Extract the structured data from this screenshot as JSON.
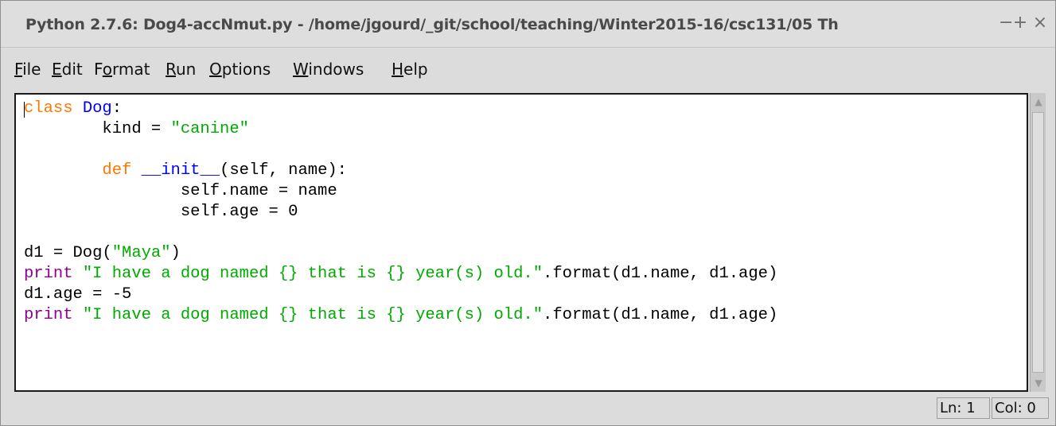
{
  "window": {
    "title": "Python 2.7.6: Dog4-accNmut.py - /home/jgourd/_git/school/teaching/Winter2015-16/csc131/05 Th",
    "controls": {
      "minimize": "−",
      "maximize": "+",
      "close": "×"
    }
  },
  "menu": {
    "file": {
      "mnemonic": "F",
      "rest": "ile"
    },
    "edit": {
      "mnemonic": "E",
      "rest": "dit"
    },
    "format": {
      "pre": "F",
      "mnemonic": "o",
      "rest": "rmat"
    },
    "run": {
      "mnemonic": "R",
      "rest": "un"
    },
    "options": {
      "mnemonic": "O",
      "rest": "ptions"
    },
    "windows": {
      "mnemonic": "W",
      "rest": "indows"
    },
    "help": {
      "mnemonic": "H",
      "rest": "elp"
    }
  },
  "editor": {
    "lines": [
      [
        {
          "t": "class ",
          "c": "kw"
        },
        {
          "t": "Dog",
          "c": "def"
        },
        {
          "t": ":",
          "c": ""
        }
      ],
      [
        {
          "t": "        kind = ",
          "c": ""
        },
        {
          "t": "\"canine\"",
          "c": "str"
        }
      ],
      [],
      [
        {
          "t": "        ",
          "c": ""
        },
        {
          "t": "def ",
          "c": "kw"
        },
        {
          "t": "__init__",
          "c": "def"
        },
        {
          "t": "(self, name):",
          "c": ""
        }
      ],
      [
        {
          "t": "                self.name = name",
          "c": ""
        }
      ],
      [
        {
          "t": "                self.age = 0",
          "c": ""
        }
      ],
      [],
      [
        {
          "t": "d1 = Dog(",
          "c": ""
        },
        {
          "t": "\"Maya\"",
          "c": "str"
        },
        {
          "t": ")",
          "c": ""
        }
      ],
      [
        {
          "t": "print ",
          "c": "bi"
        },
        {
          "t": "\"I have a dog named {} that is {} year(s) old.\"",
          "c": "str"
        },
        {
          "t": ".format(d1.name, d1.age)",
          "c": ""
        }
      ],
      [
        {
          "t": "d1.age = -5",
          "c": ""
        }
      ],
      [
        {
          "t": "print ",
          "c": "bi"
        },
        {
          "t": "\"I have a dog named {} that is {} year(s) old.\"",
          "c": "str"
        },
        {
          "t": ".format(d1.name, d1.age)",
          "c": ""
        }
      ]
    ],
    "colors": {
      "keyword": "#ff7700",
      "definition": "#0000ff",
      "string": "#00aa00",
      "builtin": "#900090"
    }
  },
  "scrollbar": {
    "up_arrow": "▲",
    "down_arrow": "▼"
  },
  "status": {
    "line": "Ln: 1",
    "col": "Col: 0"
  }
}
